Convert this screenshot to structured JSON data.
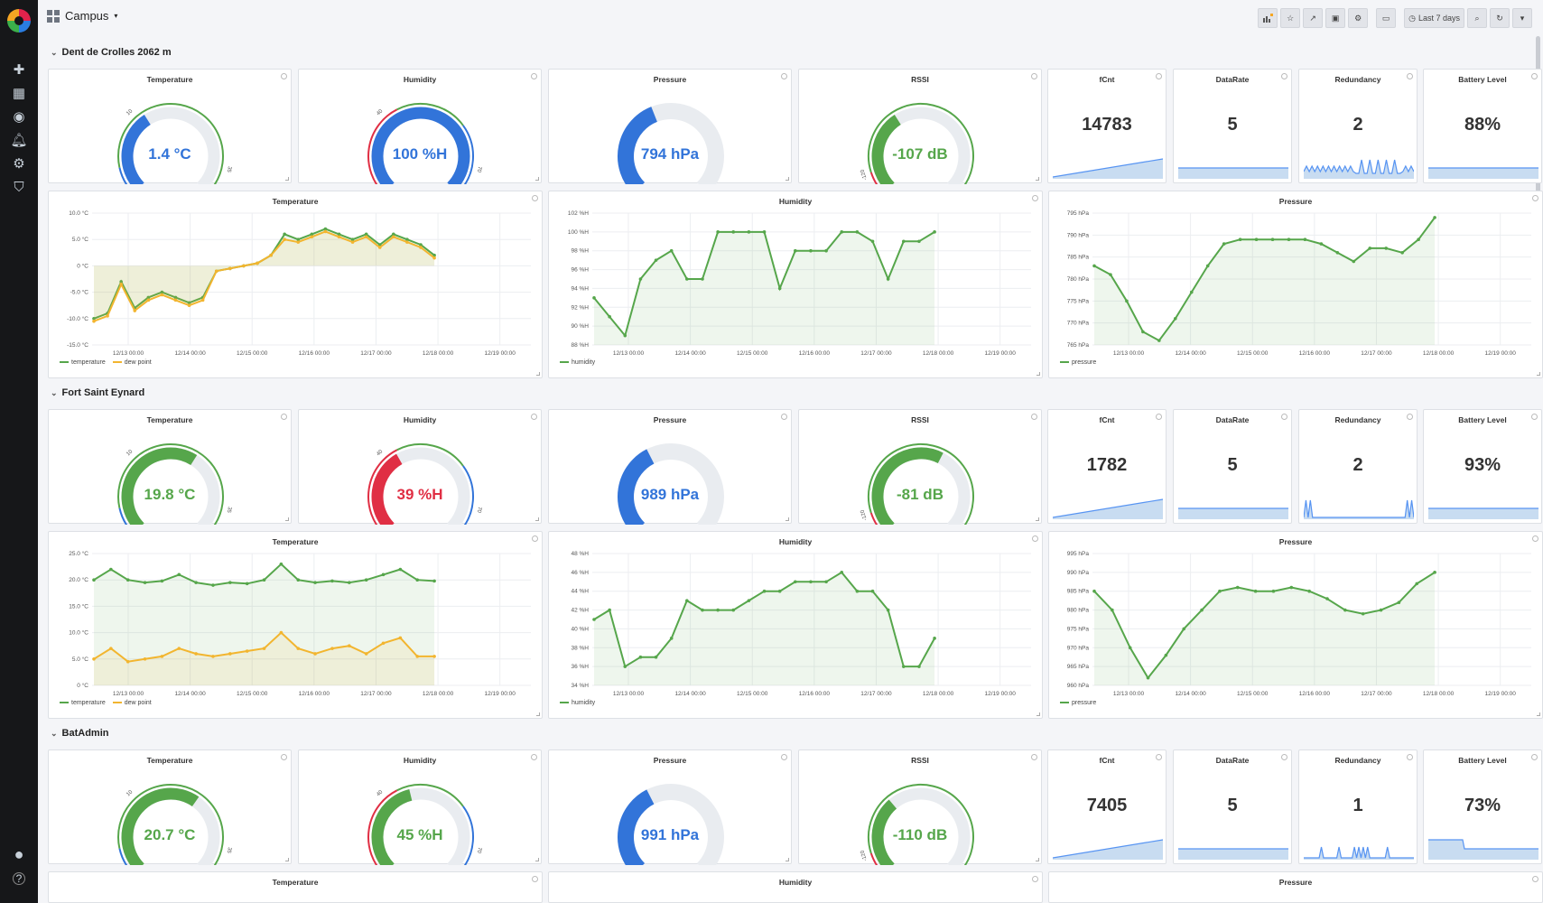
{
  "header": {
    "title": "Campus",
    "time_range": "Last 7 days"
  },
  "colors": {
    "green": "#56a64b",
    "blue": "#3274d9",
    "red": "#e02f44",
    "orange": "#f2b52f",
    "grey": "#e9ecf0"
  },
  "rows": [
    {
      "title": "Dent de Crolles 2062 m",
      "gauges": [
        {
          "title": "Temperature",
          "value": "1.4 °C",
          "fraction": 0.38,
          "color": "blue",
          "thresholds": [
            {
              "at": 0.12,
              "color": "blue"
            },
            {
              "at": 0.96,
              "color": "green"
            },
            {
              "at": 1.0,
              "color": "red"
            }
          ],
          "ticks": [
            "-10",
            "10",
            "35",
            "40"
          ]
        },
        {
          "title": "Humidity",
          "value": "100 %H",
          "fraction": 1.0,
          "color": "blue",
          "thresholds": [
            {
              "at": 0.4,
              "color": "red"
            },
            {
              "at": 0.7,
              "color": "green"
            },
            {
              "at": 1.0,
              "color": "blue"
            }
          ],
          "ticks": [
            "0",
            "40",
            "70",
            "100"
          ]
        },
        {
          "title": "Pressure",
          "value": "794 hPa",
          "fraction": 0.42,
          "color": "blue",
          "thresholds": [],
          "ticks": []
        },
        {
          "title": "RSSI",
          "value": "-107 dB",
          "fraction": 0.38,
          "color": "green",
          "thresholds": [
            {
              "at": 0.1,
              "color": "red"
            },
            {
              "at": 1.0,
              "color": "green"
            }
          ],
          "ticks": [
            "-130",
            "-120",
            "-30"
          ]
        }
      ],
      "stats": [
        {
          "title": "fCnt",
          "value": "14783",
          "spark": "ramp"
        },
        {
          "title": "DataRate",
          "value": "5",
          "spark": "flat"
        },
        {
          "title": "Redundancy",
          "value": "2",
          "spark": "noisy"
        },
        {
          "title": "Battery Level",
          "value": "88%",
          "spark": "flat"
        }
      ],
      "charts": [
        {
          "title": "Temperature",
          "type": "line",
          "ylabels": [
            "10.0 °C",
            "5.0 °C",
            "0 °C",
            "-5.0 °C",
            "-10.0 °C",
            "-15.0 °C"
          ],
          "ylim": [
            -15,
            10
          ],
          "x": [
            "12/13 00:00",
            "12/14 00:00",
            "12/15 00:00",
            "12/16 00:00",
            "12/17 00:00",
            "12/18 00:00",
            "12/19 00:00"
          ],
          "series": [
            {
              "name": "temperature",
              "color": "green",
              "values": [
                -10,
                -9,
                -3,
                -8,
                -6,
                -5,
                -6,
                -7,
                -6,
                -1,
                -0.5,
                0,
                0.5,
                2,
                6,
                5,
                6,
                7,
                6,
                5,
                6,
                4,
                6,
                5,
                4,
                2
              ]
            },
            {
              "name": "dew point",
              "color": "orange",
              "values": [
                -10.5,
                -9.5,
                -3.5,
                -8.5,
                -6.5,
                -5.5,
                -6.5,
                -7.5,
                -6.5,
                -1,
                -0.5,
                0,
                0.5,
                2,
                5,
                4.5,
                5.5,
                6.5,
                5.5,
                4.5,
                5.5,
                3.5,
                5.5,
                4.5,
                3.5,
                1.5
              ]
            }
          ]
        },
        {
          "title": "Humidity",
          "type": "line",
          "ylabels": [
            "102 %H",
            "100 %H",
            "98 %H",
            "96 %H",
            "94 %H",
            "92 %H",
            "90 %H",
            "88 %H"
          ],
          "ylim": [
            88,
            102
          ],
          "x": [
            "12/13 00:00",
            "12/14 00:00",
            "12/15 00:00",
            "12/16 00:00",
            "12/17 00:00",
            "12/18 00:00",
            "12/19 00:00"
          ],
          "series": [
            {
              "name": "humidity",
              "color": "green",
              "values": [
                93,
                91,
                89,
                95,
                97,
                98,
                95,
                95,
                100,
                100,
                100,
                100,
                94,
                98,
                98,
                98,
                100,
                100,
                99,
                95,
                99,
                99,
                100
              ]
            }
          ]
        },
        {
          "title": "Pressure",
          "type": "line",
          "ylabels": [
            "795 hPa",
            "790 hPa",
            "785 hPa",
            "780 hPa",
            "775 hPa",
            "770 hPa",
            "765 hPa"
          ],
          "ylim": [
            765,
            795
          ],
          "x": [
            "12/13 00:00",
            "12/14 00:00",
            "12/15 00:00",
            "12/16 00:00",
            "12/17 00:00",
            "12/18 00:00",
            "12/19 00:00"
          ],
          "series": [
            {
              "name": "pressure",
              "color": "green",
              "values": [
                783,
                781,
                775,
                768,
                766,
                771,
                777,
                783,
                788,
                789,
                789,
                789,
                789,
                789,
                788,
                786,
                784,
                787,
                787,
                786,
                789,
                794
              ]
            }
          ]
        }
      ]
    },
    {
      "title": "Fort Saint Eynard",
      "gauges": [
        {
          "title": "Temperature",
          "value": "19.8 °C",
          "fraction": 0.62,
          "color": "green",
          "thresholds": [
            {
              "at": 0.12,
              "color": "blue"
            },
            {
              "at": 0.96,
              "color": "green"
            },
            {
              "at": 1.0,
              "color": "red"
            }
          ],
          "ticks": [
            "-10",
            "10",
            "35",
            "40"
          ]
        },
        {
          "title": "Humidity",
          "value": "39 %H",
          "fraction": 0.39,
          "color": "red",
          "thresholds": [
            {
              "at": 0.4,
              "color": "red"
            },
            {
              "at": 0.7,
              "color": "green"
            },
            {
              "at": 1.0,
              "color": "blue"
            }
          ],
          "ticks": [
            "0",
            "40",
            "70",
            "100"
          ]
        },
        {
          "title": "Pressure",
          "value": "989 hPa",
          "fraction": 0.4,
          "color": "blue",
          "thresholds": [],
          "ticks": []
        },
        {
          "title": "RSSI",
          "value": "-81 dB",
          "fraction": 0.6,
          "color": "green",
          "thresholds": [
            {
              "at": 0.1,
              "color": "red"
            },
            {
              "at": 1.0,
              "color": "green"
            }
          ],
          "ticks": [
            "-130",
            "-120",
            "-30"
          ]
        }
      ],
      "stats": [
        {
          "title": "fCnt",
          "value": "1782",
          "spark": "ramp"
        },
        {
          "title": "DataRate",
          "value": "5",
          "spark": "flat"
        },
        {
          "title": "Redundancy",
          "value": "2",
          "spark": "spikes"
        },
        {
          "title": "Battery Level",
          "value": "93%",
          "spark": "flat"
        }
      ],
      "charts": [
        {
          "title": "Temperature",
          "type": "line",
          "ylabels": [
            "25.0 °C",
            "20.0 °C",
            "15.0 °C",
            "10.0 °C",
            "5.0 °C",
            "0 °C"
          ],
          "ylim": [
            0,
            25
          ],
          "x": [
            "12/13 00:00",
            "12/14 00:00",
            "12/15 00:00",
            "12/16 00:00",
            "12/17 00:00",
            "12/18 00:00",
            "12/19 00:00"
          ],
          "series": [
            {
              "name": "temperature",
              "color": "green",
              "values": [
                20,
                22,
                20,
                19.5,
                19.8,
                21,
                19.5,
                19,
                19.5,
                19.3,
                20,
                23,
                20,
                19.5,
                19.8,
                19.5,
                20,
                21,
                22,
                20,
                19.8
              ]
            },
            {
              "name": "dew point",
              "color": "orange",
              "values": [
                5,
                7,
                4.5,
                5,
                5.5,
                7,
                6,
                5.5,
                6,
                6.5,
                7,
                10,
                7,
                6,
                7,
                7.5,
                6,
                8,
                9,
                5.5,
                5.5
              ]
            }
          ]
        },
        {
          "title": "Humidity",
          "type": "line",
          "ylabels": [
            "48 %H",
            "46 %H",
            "44 %H",
            "42 %H",
            "40 %H",
            "38 %H",
            "36 %H",
            "34 %H"
          ],
          "ylim": [
            34,
            48
          ],
          "x": [
            "12/13 00:00",
            "12/14 00:00",
            "12/15 00:00",
            "12/16 00:00",
            "12/17 00:00",
            "12/18 00:00",
            "12/19 00:00"
          ],
          "series": [
            {
              "name": "humidity",
              "color": "green",
              "values": [
                41,
                42,
                36,
                37,
                37,
                39,
                43,
                42,
                42,
                42,
                43,
                44,
                44,
                45,
                45,
                45,
                46,
                44,
                44,
                42,
                36,
                36,
                39
              ]
            }
          ]
        },
        {
          "title": "Pressure",
          "type": "line",
          "ylabels": [
            "995 hPa",
            "990 hPa",
            "985 hPa",
            "980 hPa",
            "975 hPa",
            "970 hPa",
            "965 hPa",
            "960 hPa"
          ],
          "ylim": [
            960,
            995
          ],
          "x": [
            "12/13 00:00",
            "12/14 00:00",
            "12/15 00:00",
            "12/16 00:00",
            "12/17 00:00",
            "12/18 00:00",
            "12/19 00:00"
          ],
          "series": [
            {
              "name": "pressure",
              "color": "green",
              "values": [
                985,
                980,
                970,
                962,
                968,
                975,
                980,
                985,
                986,
                985,
                985,
                986,
                985,
                983,
                980,
                979,
                980,
                982,
                987,
                990
              ]
            }
          ]
        }
      ]
    },
    {
      "title": "BatAdmin",
      "gauges": [
        {
          "title": "Temperature",
          "value": "20.7 °C",
          "fraction": 0.63,
          "color": "green",
          "thresholds": [
            {
              "at": 0.12,
              "color": "blue"
            },
            {
              "at": 0.96,
              "color": "green"
            },
            {
              "at": 1.0,
              "color": "red"
            }
          ],
          "ticks": [
            "-10",
            "10",
            "35",
            "40"
          ]
        },
        {
          "title": "Humidity",
          "value": "45 %H",
          "fraction": 0.45,
          "color": "green",
          "thresholds": [
            {
              "at": 0.4,
              "color": "red"
            },
            {
              "at": 0.7,
              "color": "green"
            },
            {
              "at": 1.0,
              "color": "blue"
            }
          ],
          "ticks": [
            "0",
            "40",
            "70",
            "100"
          ]
        },
        {
          "title": "Pressure",
          "value": "991 hPa",
          "fraction": 0.4,
          "color": "blue",
          "thresholds": [],
          "ticks": []
        },
        {
          "title": "RSSI",
          "value": "-110 dB",
          "fraction": 0.35,
          "color": "green",
          "thresholds": [
            {
              "at": 0.1,
              "color": "red"
            },
            {
              "at": 1.0,
              "color": "green"
            }
          ],
          "ticks": [
            "-130",
            "-120",
            "-30"
          ]
        }
      ],
      "stats": [
        {
          "title": "fCnt",
          "value": "7405",
          "spark": "ramp"
        },
        {
          "title": "DataRate",
          "value": "5",
          "spark": "flat"
        },
        {
          "title": "Redundancy",
          "value": "1",
          "spark": "sparse"
        },
        {
          "title": "Battery Level",
          "value": "73%",
          "spark": "drop"
        }
      ],
      "charts": [
        {
          "title": "Temperature"
        },
        {
          "title": "Humidity"
        },
        {
          "title": "Pressure"
        }
      ]
    }
  ]
}
